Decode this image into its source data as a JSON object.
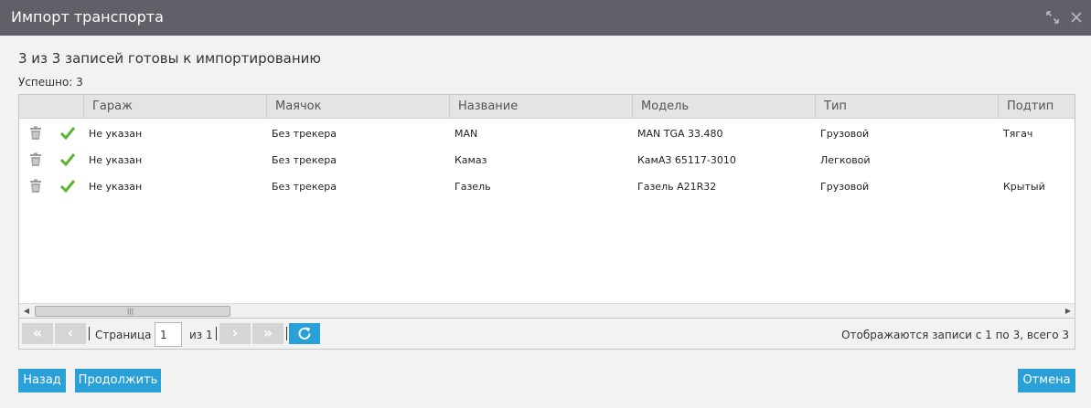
{
  "window": {
    "title": "Импорт транспорта"
  },
  "summary": {
    "heading": "3 из 3 записей готовы к импортированию",
    "success": "Успешно: 3"
  },
  "table": {
    "columns": [
      "Гараж",
      "Маячок",
      "Название",
      "Модель",
      "Тип",
      "Подтип"
    ],
    "rows": [
      {
        "garage": "Не указан",
        "tracker": "Без трекера",
        "name": "MAN",
        "model": "MAN TGA 33.480",
        "type": "Грузовой",
        "subtype": "Тягач"
      },
      {
        "garage": "Не указан",
        "tracker": "Без трекера",
        "name": "Камаз",
        "model": "КамАЗ 65117-3010",
        "type": "Легковой",
        "subtype": ""
      },
      {
        "garage": "Не указан",
        "tracker": "Без трекера",
        "name": "Газель",
        "model": "Газель A21R32",
        "type": "Грузовой",
        "subtype": "Крытый"
      }
    ]
  },
  "pager": {
    "page_label": "Страница",
    "page_value": "1",
    "of_label": "из 1",
    "info": "Отображаются записи с 1 по 3, всего 3"
  },
  "buttons": {
    "back": "Назад",
    "continue": "Продолжить",
    "cancel": "Отмена"
  },
  "icons": {
    "expand": "expand-icon",
    "close": "close-icon",
    "trash": "trash-icon",
    "check": "check-icon",
    "first": "first-page-icon",
    "prev": "prev-page-icon",
    "next": "next-page-icon",
    "last": "last-page-icon",
    "refresh": "refresh-icon"
  },
  "colors": {
    "titlebar": "#5f6068",
    "accent": "#2aa0d8",
    "check": "#5cb531"
  }
}
